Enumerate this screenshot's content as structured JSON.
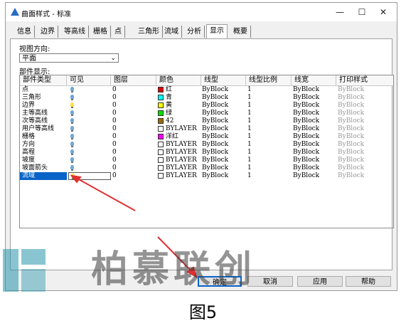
{
  "window": {
    "title": "曲面样式 - 标准",
    "controls": [
      "—",
      "☐",
      "✕"
    ]
  },
  "tabs": [
    "信息",
    "边界",
    "等高线",
    "栅格",
    "点",
    "三角形",
    "流域",
    "分析",
    "显示",
    "概要"
  ],
  "active_tab": "显示",
  "view_direction": {
    "label": "视图方向:",
    "value": "平面"
  },
  "component_display_label": "部件显示:",
  "columns": [
    "部件类型",
    "可见",
    "图层",
    "颜色",
    "线型",
    "线型比例",
    "线宽",
    "打印样式"
  ],
  "rows": [
    {
      "name": "点",
      "visible": "on",
      "layer": "0",
      "color_name": "红",
      "color": "#e00000",
      "linetype": "ByBlock",
      "scale": "1",
      "lineweight": "ByBlock",
      "plot": "ByBlock"
    },
    {
      "name": "三角形",
      "visible": "on",
      "layer": "0",
      "color_name": "青",
      "color": "#00ffff",
      "linetype": "ByBlock",
      "scale": "1",
      "lineweight": "ByBlock",
      "plot": "ByBlock"
    },
    {
      "name": "边界",
      "visible": "yellow",
      "layer": "0",
      "color_name": "黄",
      "color": "#ffff00",
      "linetype": "ByBlock",
      "scale": "1",
      "lineweight": "ByBlock",
      "plot": "ByBlock"
    },
    {
      "name": "主等高线",
      "visible": "on",
      "layer": "0",
      "color_name": "绿",
      "color": "#00e000",
      "linetype": "ByBlock",
      "scale": "1",
      "lineweight": "ByBlock",
      "plot": "ByBlock"
    },
    {
      "name": "次等高线",
      "visible": "on",
      "layer": "0",
      "color_name": "42",
      "color": "#9a6a10",
      "linetype": "ByBlock",
      "scale": "1",
      "lineweight": "ByBlock",
      "plot": "ByBlock"
    },
    {
      "name": "用户等高线",
      "visible": "on",
      "layer": "0",
      "color_name": "BYLAYER",
      "color": "#ffffff",
      "linetype": "ByBlock",
      "scale": "1",
      "lineweight": "ByBlock",
      "plot": "ByBlock"
    },
    {
      "name": "栅格",
      "visible": "on",
      "layer": "0",
      "color_name": "洋红",
      "color": "#ff00ff",
      "linetype": "ByBlock",
      "scale": "1",
      "lineweight": "ByBlock",
      "plot": "ByBlock"
    },
    {
      "name": "方向",
      "visible": "on",
      "layer": "0",
      "color_name": "BYLAYER",
      "color": "#ffffff",
      "linetype": "ByBlock",
      "scale": "1",
      "lineweight": "ByBlock",
      "plot": "ByBlock"
    },
    {
      "name": "高程",
      "visible": "on",
      "layer": "0",
      "color_name": "BYLAYER",
      "color": "#ffffff",
      "linetype": "ByBlock",
      "scale": "1",
      "lineweight": "ByBlock",
      "plot": "ByBlock"
    },
    {
      "name": "坡度",
      "visible": "on",
      "layer": "0",
      "color_name": "BYLAYER",
      "color": "#ffffff",
      "linetype": "ByBlock",
      "scale": "1",
      "lineweight": "ByBlock",
      "plot": "ByBlock"
    },
    {
      "name": "坡面箭头",
      "visible": "on",
      "layer": "0",
      "color_name": "BYLAYER",
      "color": "#ffffff",
      "linetype": "ByBlock",
      "scale": "1",
      "lineweight": "ByBlock",
      "plot": "ByBlock"
    },
    {
      "name": "流域",
      "visible": "yellow",
      "layer": "0",
      "color_name": "BYLAYER",
      "color": "#ffffff",
      "linetype": "ByBlock",
      "scale": "1",
      "lineweight": "ByBlock",
      "plot": "ByBlock",
      "selected": true
    }
  ],
  "buttons": {
    "ok": "确定",
    "cancel": "取消",
    "apply": "应用",
    "help": "帮助"
  },
  "colors": {
    "accent": "#0a64c8",
    "arrow": "#e03030"
  },
  "watermark": "柏慕联创",
  "caption": "图5"
}
